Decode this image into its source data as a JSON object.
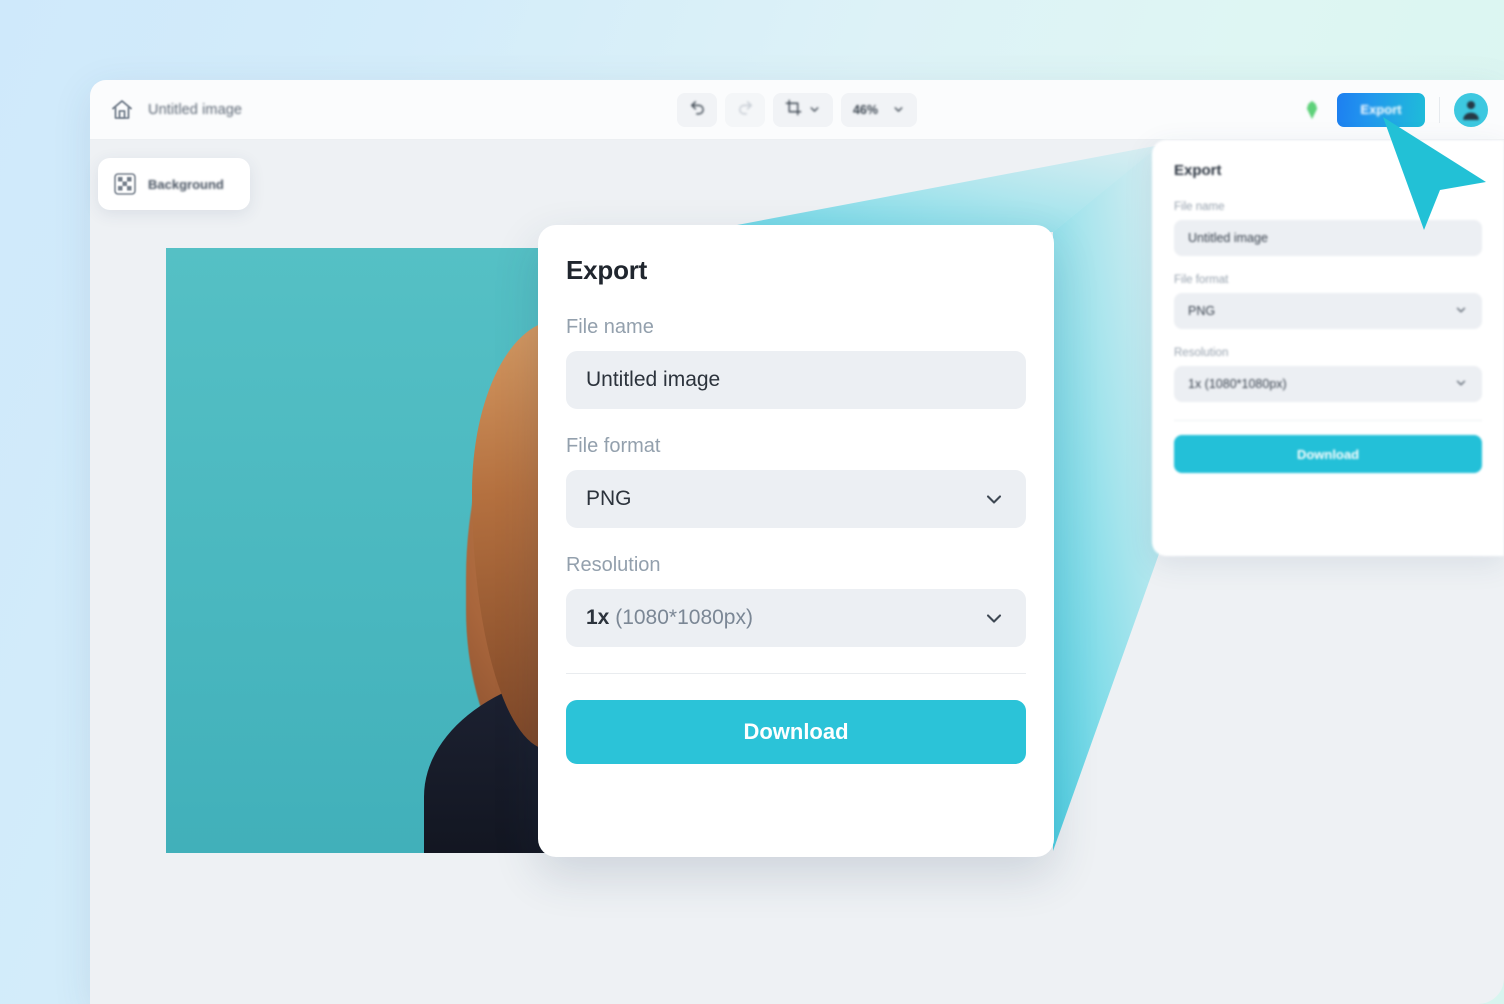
{
  "app": {
    "document_title": "Untitled image",
    "home_icon": "home-icon"
  },
  "toolbar": {
    "undo_icon": "undo-icon",
    "redo_icon": "redo-icon",
    "crop_icon": "crop-icon",
    "crop_chevron_icon": "chevron-down-icon",
    "zoom_value": "46%",
    "zoom_chevron_icon": "chevron-down-icon",
    "gem_icon": "gem-icon",
    "export_label": "Export",
    "avatar_icon": "user-avatar-icon"
  },
  "canvas": {
    "background_chip_label": "Background",
    "background_chip_icon": "checkerboard-icon"
  },
  "export_popup": {
    "title": "Export",
    "file_name_label": "File name",
    "file_name_value": "Untitled image",
    "file_name_placeholder": "Untitled image",
    "file_format_label": "File format",
    "file_format_value": "PNG",
    "file_format_chevron_icon": "chevron-down-icon",
    "resolution_label": "Resolution",
    "resolution_multiplier": "1x",
    "resolution_dimensions": "(1080*1080px)",
    "resolution_chevron_icon": "chevron-down-icon",
    "download_label": "Download"
  },
  "export_panel": {
    "title": "Export",
    "file_name_label": "File name",
    "file_name_value": "Untitled image",
    "file_format_label": "File format",
    "file_format_value": "PNG",
    "resolution_label": "Resolution",
    "resolution_value": "1x (1080*1080px)",
    "download_label": "Download"
  },
  "colors": {
    "accent_cyan": "#2bc3d8",
    "export_gradient_start": "#1d7ff0",
    "export_gradient_end": "#1fbcd9",
    "cursor": "#22c1d6",
    "field_bg": "#eceff3",
    "canvas_bg": "#eef1f4",
    "artwork_bg": "#4fbdc3",
    "page_gradient_start": "#cfe9fb",
    "page_gradient_end": "#d8f5ef"
  }
}
